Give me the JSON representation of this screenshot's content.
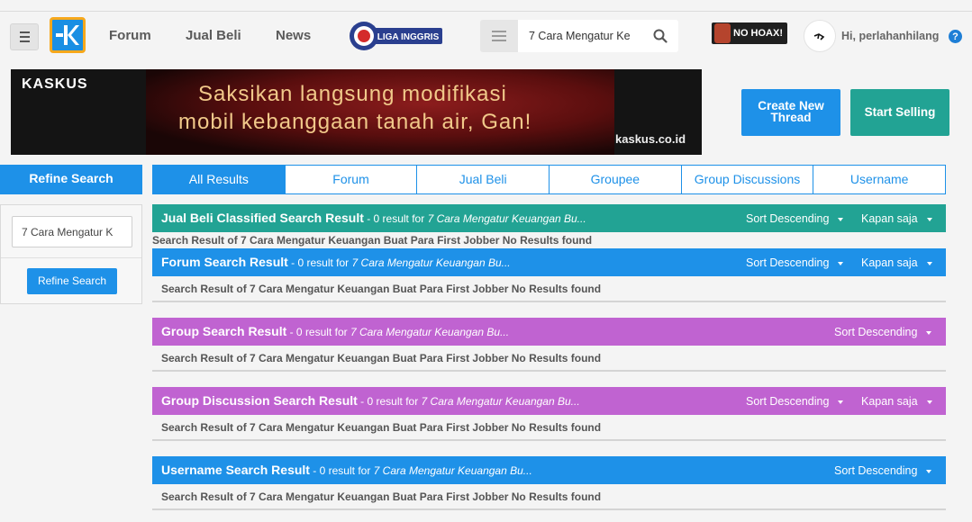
{
  "header": {
    "nav": [
      "Forum",
      "Jual Beli",
      "News"
    ],
    "liga_label": "LIGA INGGRIS",
    "search_value": "7 Cara Mengatur Ke",
    "nohoax_label": "NO HOAX!",
    "greeting": "Hi, perlahanhilang",
    "help_label": "?"
  },
  "banner": {
    "brand": "KASKUS",
    "line1": "Saksikan langsung modifikasi",
    "line2": "mobil kebanggaan tanah air, Gan!",
    "url": "kaskus.co.id"
  },
  "actions": {
    "create_thread": "Create New Thread",
    "start_selling": "Start Selling"
  },
  "sidebar": {
    "title": "Refine Search",
    "input_value": "7 Cara Mengatur K",
    "button": "Refine Search"
  },
  "tabs": [
    "All Results",
    "Forum",
    "Jual Beli",
    "Groupee",
    "Group Discussions",
    "Username"
  ],
  "active_tab": "All Results",
  "sections": {
    "jual_beli": {
      "title": "Jual Beli Classified Search Result",
      "count": " - 0 result for ",
      "query": "7 Cara Mengatur Keuangan Bu...",
      "sort": "Sort Descending",
      "time": "Kapan saja",
      "body": "Search Result of 7 Cara Mengatur Keuangan Buat Para First Jobber No Results found"
    },
    "forum": {
      "title": "Forum Search Result",
      "count": " - 0 result for ",
      "query": "7 Cara Mengatur Keuangan Bu...",
      "sort": "Sort Descending",
      "time": "Kapan saja",
      "body": "Search Result of 7 Cara Mengatur Keuangan Buat Para First Jobber No Results found"
    },
    "group": {
      "title": "Group Search Result",
      "count": " - 0 result for ",
      "query": "7 Cara Mengatur Keuangan Bu...",
      "sort": "Sort Descending",
      "body": "Search Result of 7 Cara Mengatur Keuangan Buat Para First Jobber No Results found"
    },
    "group_discussion": {
      "title": "Group Discussion Search Result",
      "count": " - 0 result for ",
      "query": "7 Cara Mengatur Keuangan Bu...",
      "sort": "Sort Descending",
      "time": "Kapan saja",
      "body": "Search Result of 7 Cara Mengatur Keuangan Buat Para First Jobber No Results found"
    },
    "username": {
      "title": "Username Search Result",
      "count": " - 0 result for ",
      "query": "7 Cara Mengatur Keuangan Bu...",
      "sort": "Sort Descending",
      "body": "Search Result of 7 Cara Mengatur Keuangan Buat Para First Jobber No Results found"
    }
  },
  "colors": {
    "blue": "#1e91e8",
    "teal": "#22a394",
    "purple": "#c063d1"
  }
}
